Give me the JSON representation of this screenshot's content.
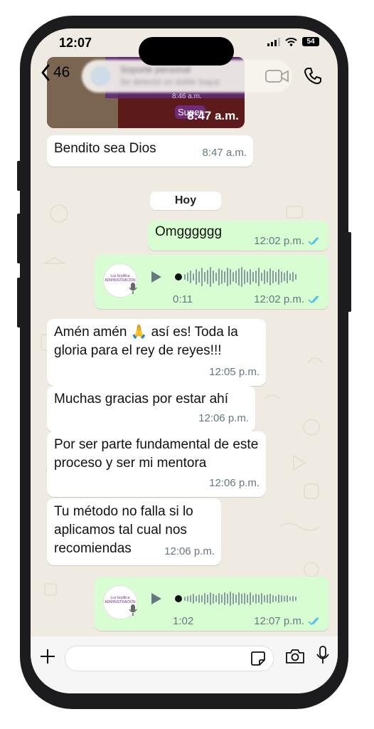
{
  "status": {
    "time": "12:07",
    "battery": "54"
  },
  "header": {
    "back_count": "46",
    "contact_name": "Soporte personal",
    "contact_status": "Se detectó un doble toque"
  },
  "image_message": {
    "inner_time": "8:46 a.m.",
    "badge": "Super",
    "time": "8:47 a.m."
  },
  "messages_prev": {
    "text": "Bendito sea Dios",
    "time": "8:47 a.m."
  },
  "day_divider": "Hoy",
  "out_text": {
    "text": "Omgggggg",
    "time": "12:02 p.m."
  },
  "voice_1": {
    "duration": "0:11",
    "time": "12:02 p.m."
  },
  "in_messages": [
    {
      "text": "Amén amén 🙏 así es! Toda la gloria para el rey de reyes!!!",
      "time": "12:05 p.m."
    },
    {
      "text": "Muchas gracias por estar ahí",
      "time": "12:06 p.m."
    },
    {
      "text": "Por ser parte fundamental de este proceso y ser mi mentora",
      "time": "12:06 p.m."
    },
    {
      "text": "Tu método no falla si lo aplicamos tal cual nos recomiendas",
      "time": "12:06 p.m."
    }
  ],
  "voice_2": {
    "duration": "1:02",
    "time": "12:07 p.m."
  },
  "avatar_label": "Luz Erpillica ADMINISTRACIÓN",
  "colors": {
    "outgoing": "#d9fdd3",
    "incoming": "#ffffff",
    "wallpaper": "#efeae2",
    "ticks": "#53bdeb"
  }
}
